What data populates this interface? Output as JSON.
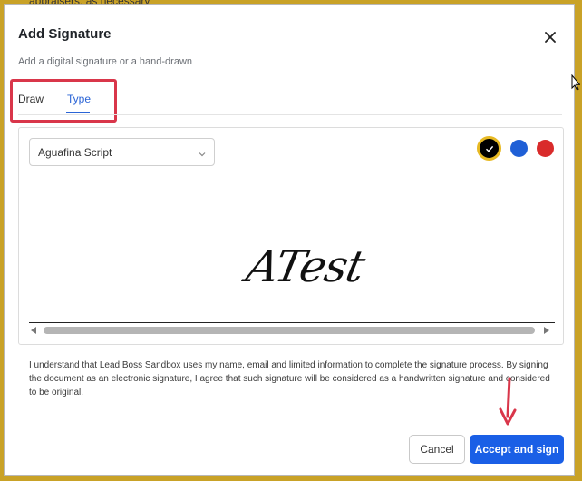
{
  "backdrop": {
    "text": "appraisers, as necessary"
  },
  "dialog": {
    "title": "Add Signature",
    "subtitle": "Add a digital signature or a hand-drawn",
    "close_icon": "close-icon"
  },
  "tabs": [
    {
      "label": "Draw",
      "active": false
    },
    {
      "label": "Type",
      "active": true
    }
  ],
  "font_select": {
    "value": "Aguafina Script",
    "icon": "chevron-down-icon"
  },
  "colors": [
    {
      "name": "black",
      "hex": "#000000",
      "selected": true
    },
    {
      "name": "blue",
      "hex": "#1f5fd6",
      "selected": false
    },
    {
      "name": "red",
      "hex": "#d92b2b",
      "selected": false
    }
  ],
  "signature": {
    "text": "ATest"
  },
  "consent_text": "I understand that Lead Boss Sandbox uses my name, email and limited information to complete the signature process. By signing the document as an electronic signature, I agree that such signature will be considered as a handwritten signature and considered to be original.",
  "buttons": {
    "cancel": "Cancel",
    "accept": "Accept and sign"
  },
  "accent_colors": {
    "primary": "#1a5fe6",
    "annotation": "#d9364a"
  }
}
